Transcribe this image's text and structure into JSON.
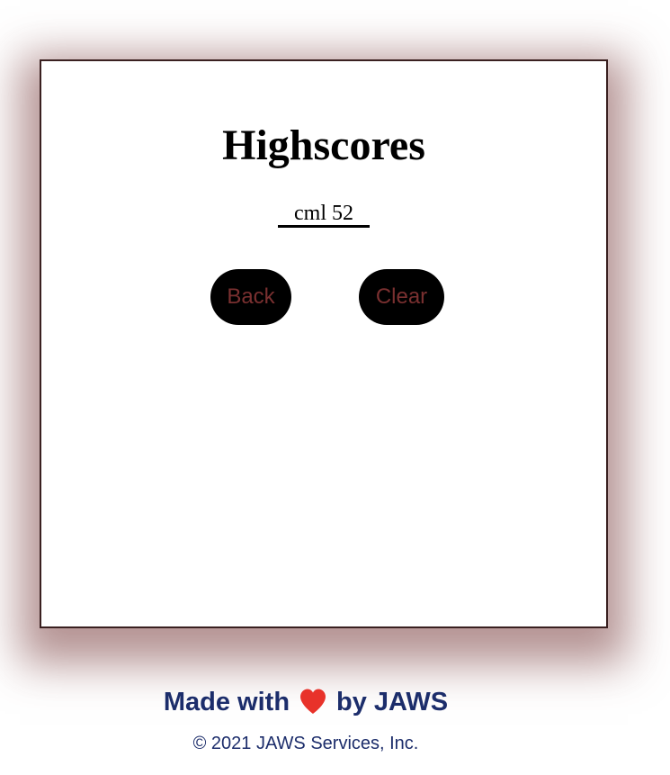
{
  "highscores": {
    "title": "Highscores",
    "entries": [
      {
        "text": "cml 52"
      }
    ]
  },
  "buttons": {
    "back_label": "Back",
    "clear_label": "Clear"
  },
  "footer": {
    "made_with": "Made with",
    "by": "by JAWS",
    "heart_icon": "heart-icon",
    "heart_color": "#e8322a",
    "copyright": "© 2021 JAWS Services, Inc."
  },
  "colors": {
    "button_bg": "#000000",
    "button_text": "#7a3030",
    "footer_text": "#1c2d6b",
    "card_border": "#3a2020"
  }
}
